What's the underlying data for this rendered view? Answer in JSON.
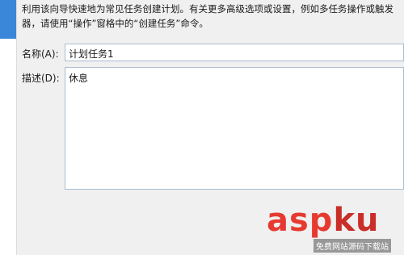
{
  "wizard": {
    "description": "利用该向导快速地为常见任务创建计划。有关更多高级选项或设置，例如多任务操作或触发\n器，请使用“操作”窗格中的“创建任务”命令。",
    "name_label": "名称(A):",
    "name_value": "计划任务1",
    "desc_label": "描述(D):",
    "desc_value": "休息"
  },
  "watermark": {
    "main_prefix": "asp",
    "main_suffix": "ku",
    "sub_text": "免费网站源码下载站"
  },
  "colors": {
    "accent": "#3a86d8",
    "watermark_red": "#e63a31"
  }
}
